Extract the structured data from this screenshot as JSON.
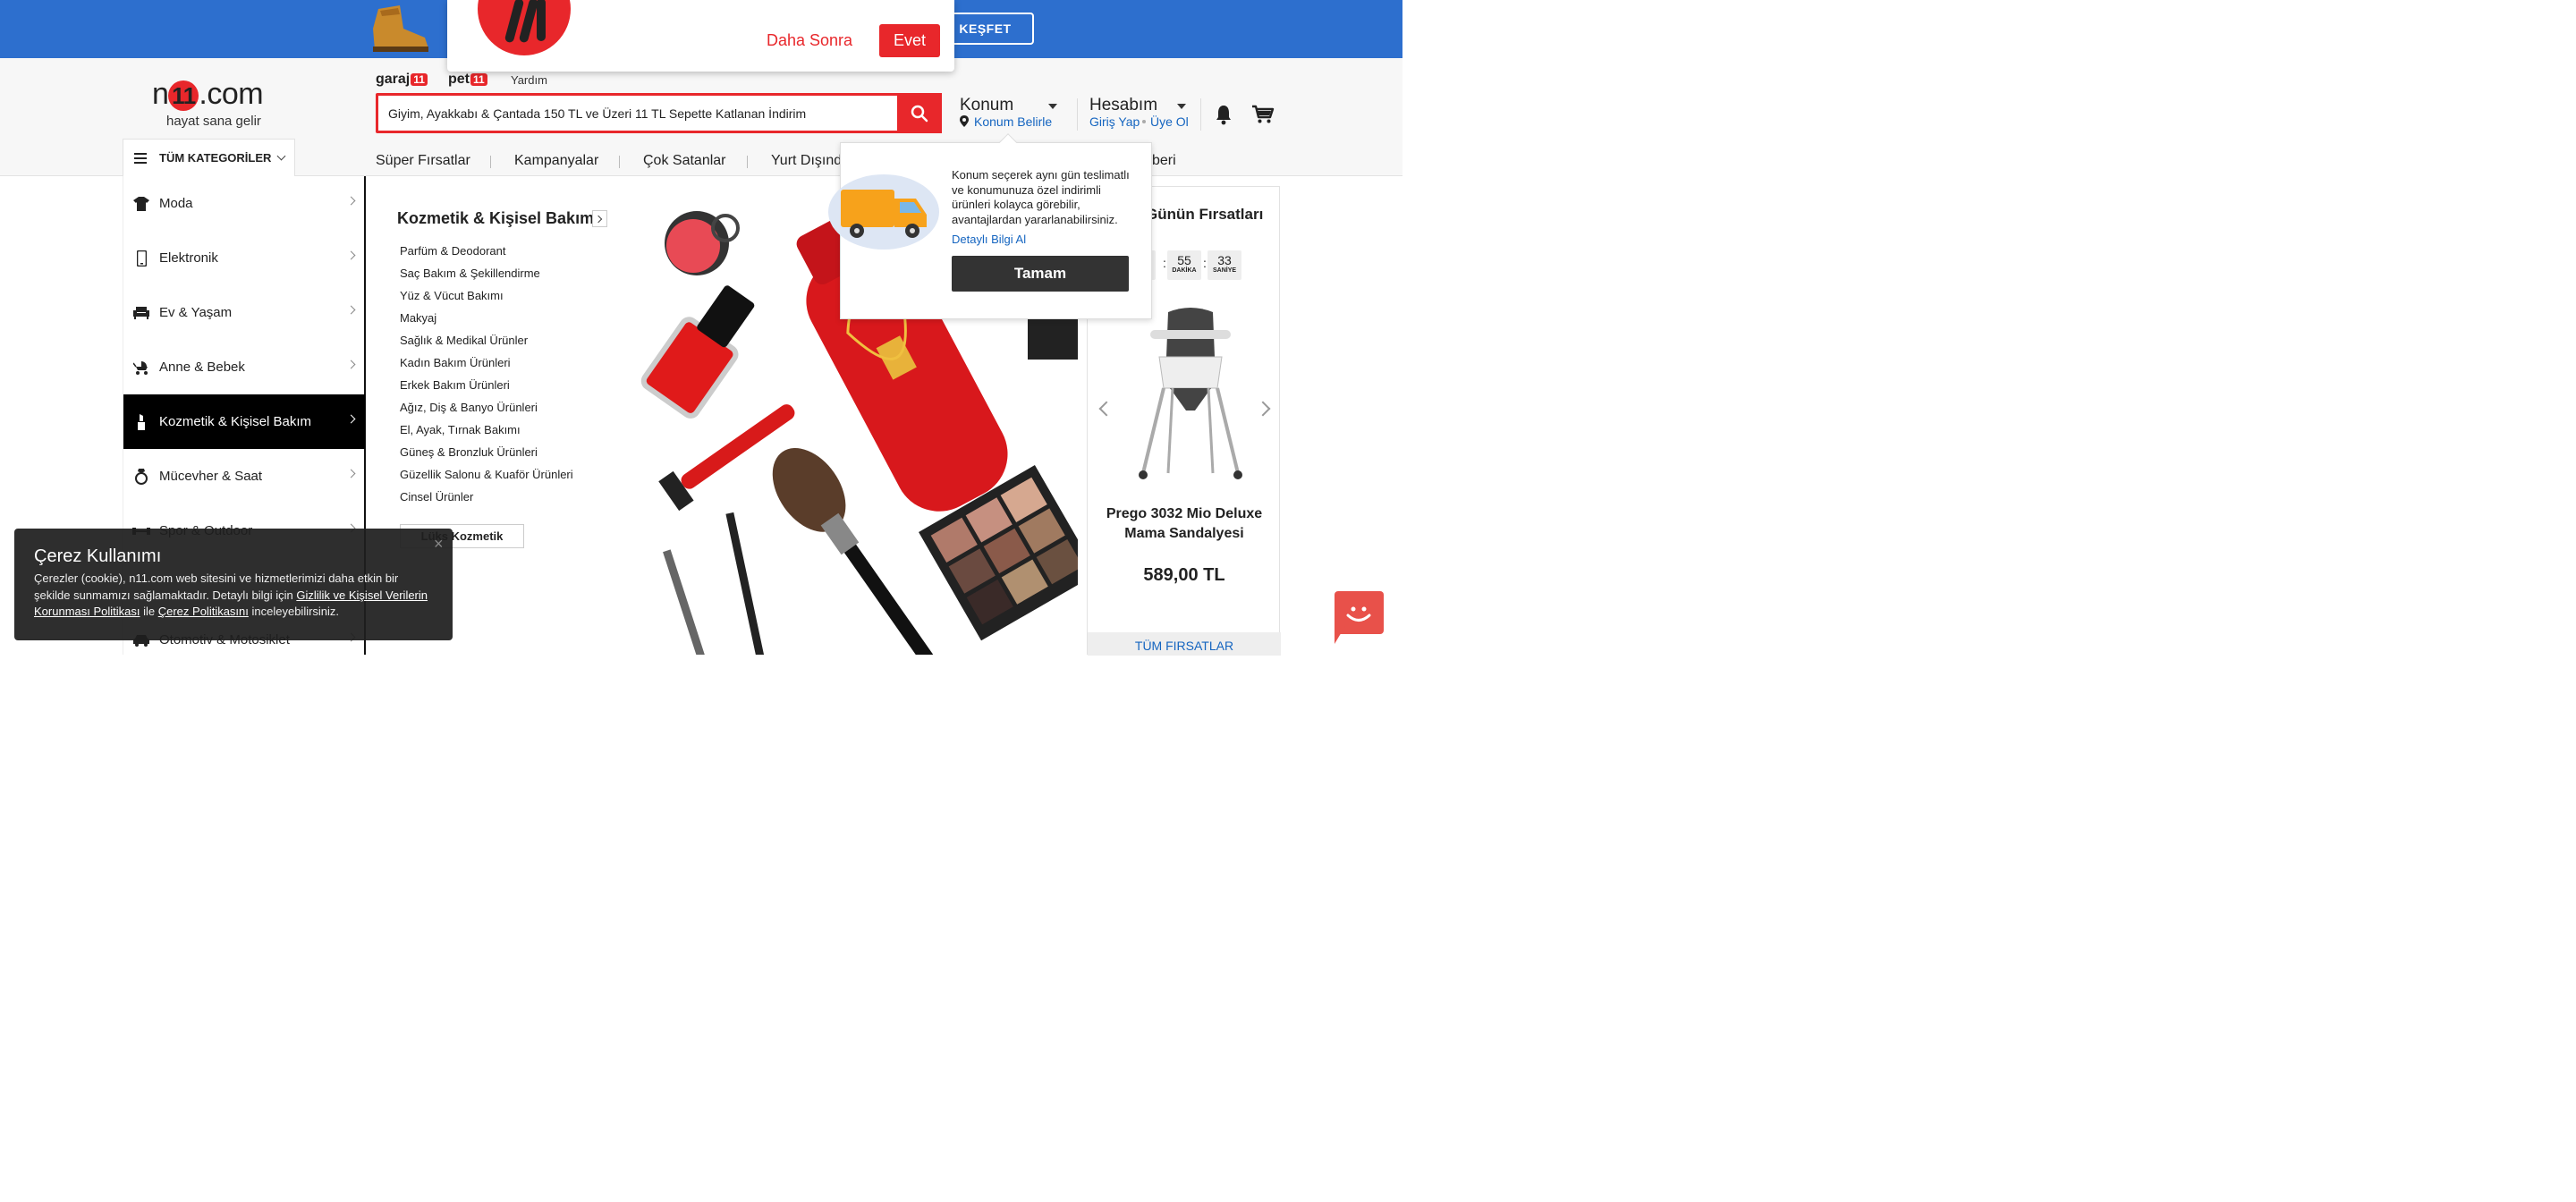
{
  "banner": {
    "cta_label": "KEŞFET"
  },
  "notification": {
    "later_label": "Daha Sonra",
    "yes_label": "Evet"
  },
  "header": {
    "logo_text_left": "n",
    "logo_text_mid": "11",
    "logo_text_right": ".com",
    "slogan": "hayat sana gelir",
    "sublinks": [
      {
        "text": "garaj",
        "badge": "11"
      },
      {
        "text": "pet",
        "badge": "11"
      }
    ],
    "help_label": "Yardım",
    "search_value": "Giyim, Ayakkabı & Çantada 150 TL ve Üzeri 11 TL Sepette Katlanan İndirim",
    "location_title": "Konum",
    "location_sub": "Konum Belirle",
    "account_title": "Hesabım",
    "login_label": "Giriş Yap",
    "register_label": "Üye Ol"
  },
  "nav": {
    "all_categories_label": "TÜM KATEGORİLER",
    "links": [
      "Süper Fırsatlar",
      "Kampanyalar",
      "Çok Satanlar",
      "Yurt Dışında",
      "beri"
    ]
  },
  "sidebar": {
    "items": [
      {
        "label": "Moda",
        "icon": "tshirt-icon"
      },
      {
        "label": "Elektronik",
        "icon": "phone-icon"
      },
      {
        "label": "Ev & Yaşam",
        "icon": "sofa-icon"
      },
      {
        "label": "Anne & Bebek",
        "icon": "stroller-icon"
      },
      {
        "label": "Kozmetik & Kişisel Bakım",
        "icon": "lipstick-icon"
      },
      {
        "label": "Mücevher & Saat",
        "icon": "ring-icon"
      },
      {
        "label": "Spor & Outdoor",
        "icon": "dumbbell-icon"
      },
      {
        "label": "Otomotiv & Motosiklet",
        "icon": "car-icon"
      }
    ]
  },
  "mega_menu": {
    "title": "Kozmetik & Kişisel Bakım",
    "items": [
      "Parfüm & Deodorant",
      "Saç Bakım & Şekillendirme",
      "Yüz & Vücut Bakımı",
      "Makyaj",
      "Sağlık & Medikal Ürünler",
      "Kadın Bakım Ürünleri",
      "Erkek Bakım Ürünleri",
      "Ağız, Diş & Banyo Ürünleri",
      "El, Ayak, Tırnak Bakımı",
      "Güneş & Bronzluk Ürünleri",
      "Güzellik Salonu & Kuaför Ürünleri",
      "Cinsel Ürünler"
    ],
    "luks_label": "Lüks Kozmetik"
  },
  "deal": {
    "title": "Günün Fırsatları",
    "timer": [
      {
        "num": "",
        "unit": ""
      },
      {
        "num": "55",
        "unit": "DAKİKA"
      },
      {
        "num": "33",
        "unit": "SANİYE"
      }
    ],
    "product_name": "Prego 3032 Mio Deluxe Mama Sandalyesi",
    "price": "589,00 TL",
    "all_label": "TÜM FIRSATLAR"
  },
  "location_popup": {
    "text": "Konum seçerek aynı gün teslimatlı ve konumunuza özel indirimli ürünleri kolayca görebilir, avantajlardan yararlanabilirsiniz.",
    "link": "Detaylı Bilgi Al",
    "button": "Tamam"
  },
  "cookie": {
    "title": "Çerez Kullanımı",
    "text_1": "Çerezler (cookie), n11.com web sitesini ve hizmetlerimizi daha etkin bir şekilde sunmamızı sağlamaktadır. Detaylı bilgi için ",
    "link_1": "Gizlilik ve Kişisel Verilerin Korunması Politikası",
    "text_2": " ile ",
    "link_2": "Çerez Politikasını",
    "text_3": " inceleyebilirsiniz.",
    "close": "×"
  },
  "colors": {
    "brand_red": "#e8272b",
    "banner_blue": "#2d6fce",
    "link_blue": "#1565c0"
  }
}
